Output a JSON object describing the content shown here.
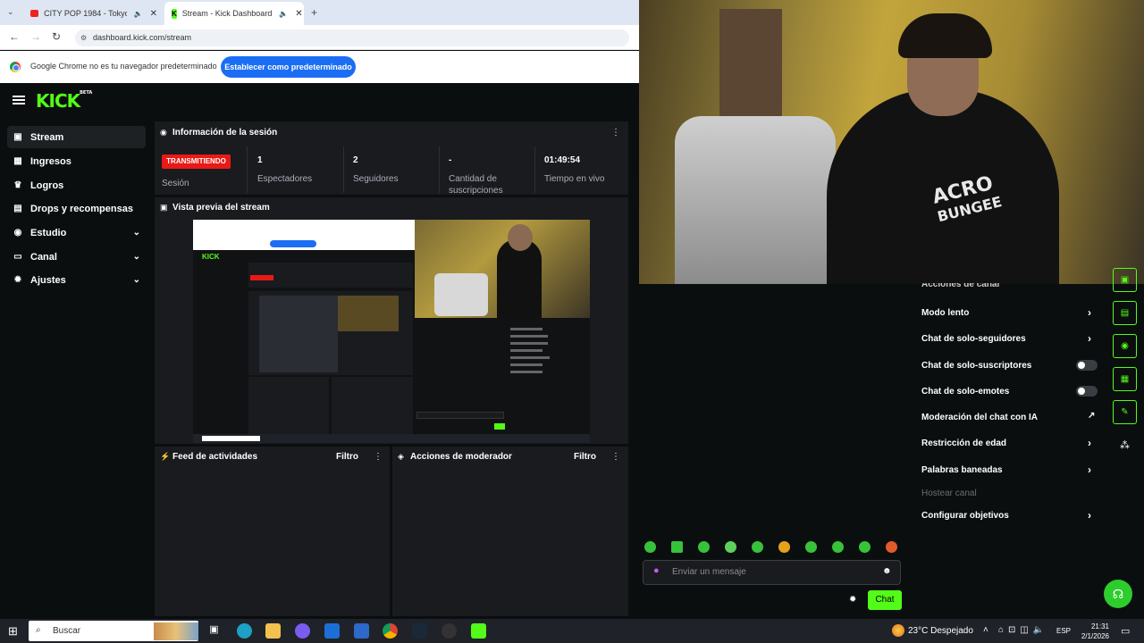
{
  "browser": {
    "tabs": [
      {
        "label": "CITY POP 1984 - Tokyo Mo"
      },
      {
        "label": "Stream - Kick Dashboard"
      }
    ],
    "url": "dashboard.kick.com/stream",
    "infobar_message": "Google Chrome no es tu navegador predeterminado",
    "infobar_button": "Establecer como predeterminado"
  },
  "sidebar": {
    "items": [
      {
        "label": "Stream",
        "icon": "stream-icon"
      },
      {
        "label": "Ingresos",
        "icon": "income-icon"
      },
      {
        "label": "Logros",
        "icon": "trophy-icon"
      },
      {
        "label": "Drops y recompensas",
        "icon": "gift-icon"
      },
      {
        "label": "Estudio",
        "icon": "studio-icon"
      },
      {
        "label": "Canal",
        "icon": "channel-icon"
      },
      {
        "label": "Ajustes",
        "icon": "gear-icon"
      }
    ]
  },
  "session": {
    "title": "Información de la sesión",
    "status": "TRANSMITIENDO",
    "status_label": "Sesión",
    "stats": [
      {
        "value": "1",
        "label": "Espectadores"
      },
      {
        "value": "2",
        "label": "Seguidores"
      },
      {
        "value": "-",
        "label": "Cantidad de suscripciones"
      },
      {
        "value": "01:49:54",
        "label": "Tiempo en vivo"
      }
    ]
  },
  "preview": {
    "title": "Vista previa del stream"
  },
  "feed": {
    "title": "Feed de actividades",
    "filter": "Filtro"
  },
  "mod_actions": {
    "title": "Acciones de moderador",
    "filter": "Filtro"
  },
  "mod_settings": {
    "header_partial": "Acciones de canal",
    "rows": [
      {
        "label": "Modo lento",
        "control": "chevron"
      },
      {
        "label": "Chat de solo-seguidores",
        "control": "chevron"
      },
      {
        "label": "Chat de solo-suscriptores",
        "control": "toggle",
        "on": false
      },
      {
        "label": "Chat de solo-emotes",
        "control": "toggle",
        "on": false
      },
      {
        "label": "Moderación del chat con IA",
        "control": "external"
      },
      {
        "label": "Restricción de edad",
        "control": "chevron"
      },
      {
        "label": "Palabras baneadas",
        "control": "chevron"
      },
      {
        "label": "Hostear canal",
        "control": "none",
        "disabled": true
      },
      {
        "label": "Configurar objetivos",
        "control": "chevron"
      }
    ]
  },
  "chat": {
    "placeholder": "Enviar un mensaje",
    "send_label": "Chat"
  },
  "cam_overlay": {
    "shirt_text_1": "ACRO",
    "shirt_text_2": "BUNGEE"
  },
  "taskbar": {
    "search_label": "Buscar",
    "weather": "23°C  Despejado",
    "lang": "ESP",
    "time": "21:31",
    "date": "2/1/2026"
  },
  "colors": {
    "accent": "#53fc18",
    "live": "#e91916",
    "panel": "#191b1f",
    "background": "#0b0e0f"
  }
}
